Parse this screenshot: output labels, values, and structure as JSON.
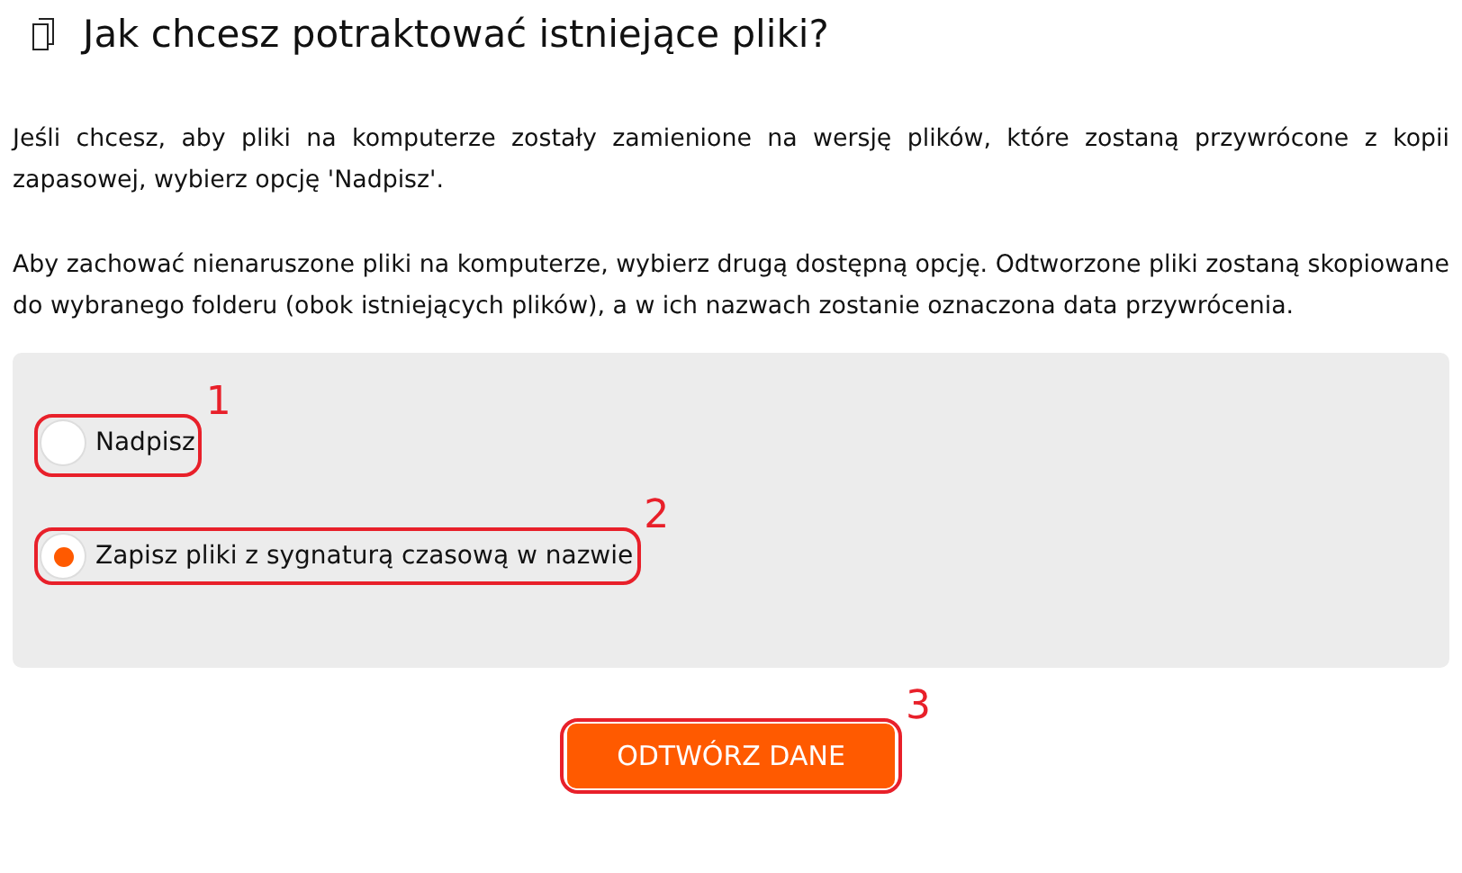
{
  "title": "Jak chcesz potraktować istniejące pliki?",
  "paragraphs": [
    "Jeśli chcesz, aby pliki na komputerze zostały zamienione na wersję plików, które zostaną przywrócone z kopii zapasowej, wybierz opcję 'Nadpisz'.",
    "Aby zachować nienaruszone pliki na komputerze, wybierz drugą dostępną opcję. Odtworzone pliki zostaną skopiowane do wybranego folderu (obok istniejących plików), a w ich nazwach zostanie oznaczona data przywrócenia."
  ],
  "options": [
    {
      "label": "Nadpisz",
      "selected": false,
      "callout": "1"
    },
    {
      "label": "Zapisz pliki z sygnaturą czasową w nazwie",
      "selected": true,
      "callout": "2"
    }
  ],
  "button": {
    "label": "ODTWÓRZ DANE",
    "callout": "3"
  }
}
